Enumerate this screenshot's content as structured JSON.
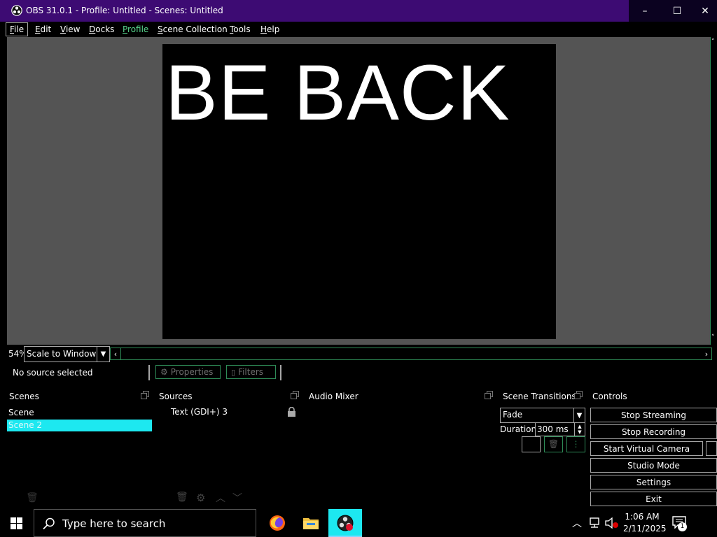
{
  "window": {
    "title": "OBS 31.0.1 - Profile: Untitled - Scenes: Untitled",
    "controls": {
      "minimize": "–",
      "maximize": "☐",
      "close": "✕"
    }
  },
  "menu": {
    "items": [
      {
        "label": "File",
        "accel": "F"
      },
      {
        "label": "Edit",
        "accel": "E"
      },
      {
        "label": "View",
        "accel": "V"
      },
      {
        "label": "Docks",
        "accel": "D"
      },
      {
        "label": "Profile",
        "accel": "P"
      },
      {
        "label": "Scene Collection",
        "accel": "S"
      },
      {
        "label": "Tools",
        "accel": "T"
      },
      {
        "label": "Help",
        "accel": "H"
      }
    ]
  },
  "preview": {
    "canvas_text": "BE BACK",
    "zoom_percent": "54%",
    "scale_mode": "Scale to Window"
  },
  "source_toolbar": {
    "status": "No source selected",
    "properties_label": "Properties",
    "filters_label": "Filters"
  },
  "docks": {
    "scenes": {
      "title": "Scenes",
      "items": [
        "Scene",
        "Scene 2"
      ],
      "selected_index": 1
    },
    "sources": {
      "title": "Sources",
      "items": [
        {
          "name": "Text (GDI+) 3",
          "locked": true
        }
      ]
    },
    "audio_mixer": {
      "title": "Audio Mixer"
    },
    "scene_transitions": {
      "title": "Scene Transitions",
      "transition": "Fade",
      "duration_label": "Duration",
      "duration_value": "300 ms"
    },
    "controls": {
      "title": "Controls",
      "buttons": [
        "Stop Streaming",
        "Stop Recording",
        "Start Virtual Camera",
        "Studio Mode",
        "Settings",
        "Exit"
      ]
    }
  },
  "taskbar": {
    "search_placeholder": "Type here to search",
    "time": "1:06 AM",
    "date": "2/11/2025",
    "notification_count": "1"
  },
  "colors": {
    "titlebar": "#3d0b73",
    "selection": "#1de8f0",
    "accent_border": "#2e8b57",
    "profile_menu": "#58d68d"
  }
}
